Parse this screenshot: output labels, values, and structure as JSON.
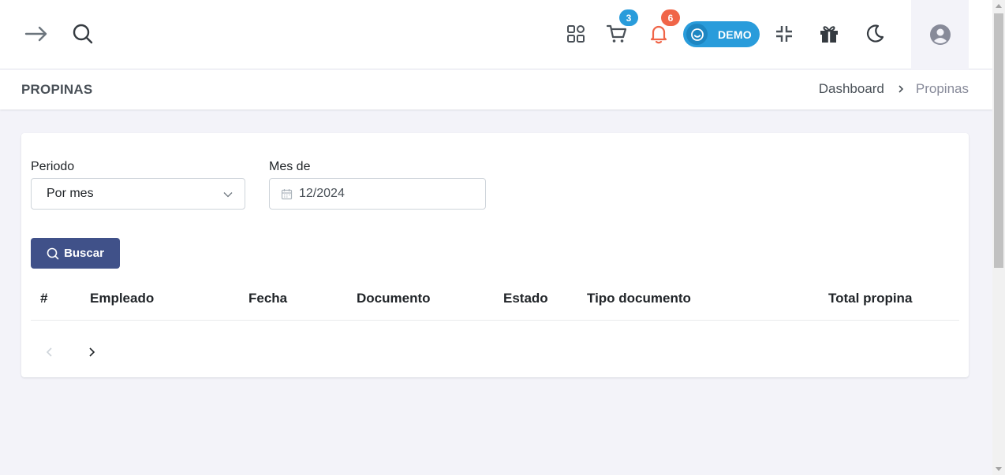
{
  "topbar": {
    "icons": {
      "menu_toggle": "arrow-right-icon",
      "search": "search-icon",
      "apps": "apps-grid-icon",
      "cart": "cart-icon",
      "notifications": "bell-icon",
      "fullscreen": "fullscreen-exit-icon",
      "gift": "gift-icon",
      "theme": "moon-icon",
      "user": "user-circle-icon"
    },
    "cart_count": "3",
    "notification_count": "6",
    "demo_label": "DEMO",
    "colors": {
      "cart_badge": "#299cdb",
      "notification_badge": "#f06548",
      "demo_pill": "#299cdb"
    }
  },
  "page": {
    "title": "PROPINAS",
    "breadcrumb": {
      "parent": "Dashboard",
      "current": "Propinas"
    }
  },
  "filters": {
    "period_label": "Periodo",
    "period_value": "Por mes",
    "month_label": "Mes de",
    "month_value": "12/2024",
    "search_button": "Buscar",
    "colors": {
      "primary": "#405189"
    }
  },
  "table": {
    "columns": [
      "#",
      "Empleado",
      "Fecha",
      "Documento",
      "Estado",
      "Tipo documento",
      "Total propina"
    ],
    "rows": []
  },
  "pagination": {
    "prev_icon": "chevron-left-icon",
    "next_icon": "chevron-right-icon"
  }
}
